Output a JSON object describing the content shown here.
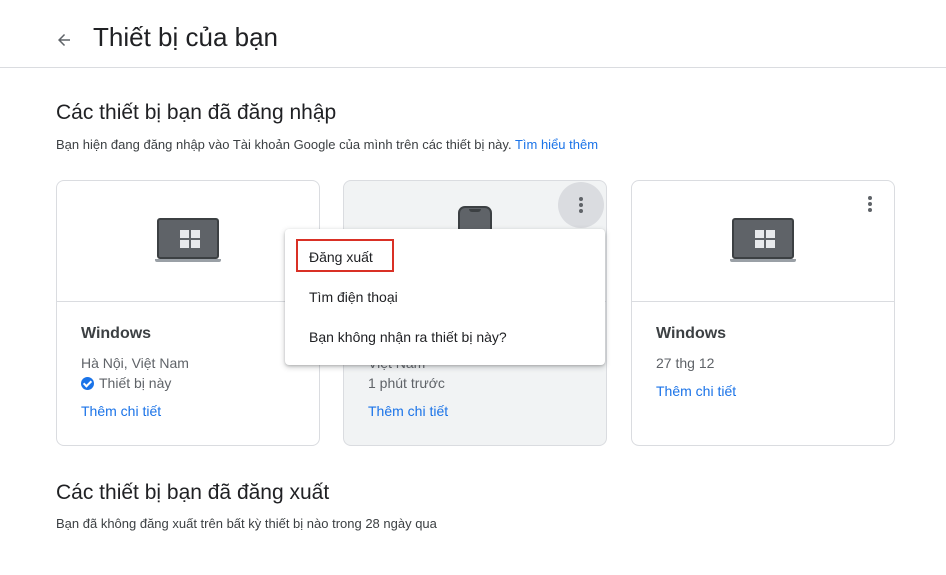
{
  "header": {
    "title": "Thiết bị của bạn",
    "back_icon": "arrow-back-icon"
  },
  "signed_in": {
    "title": "Các thiết bị bạn đã đăng nhập",
    "description": "Bạn hiện đang đăng nhập vào Tài khoản Google của mình trên các thiết bị này.",
    "learn_more": "Tìm hiểu thêm"
  },
  "devices": [
    {
      "icon": "windows-laptop-icon",
      "name": "Windows",
      "location": "Hà Nội, Việt Nam",
      "this_device": "Thiết bị này",
      "details_link": "Thêm chi tiết"
    },
    {
      "icon": "phone-icon",
      "location": "Việt Nam",
      "time": "1 phút trước",
      "details_link": "Thêm chi tiết"
    },
    {
      "icon": "windows-laptop-icon",
      "name": "Windows",
      "date": "27 thg 12",
      "details_link": "Thêm chi tiết"
    }
  ],
  "menu": {
    "items": [
      "Đăng xuất",
      "Tìm điện thoại",
      "Bạn không nhận ra thiết bị này?"
    ]
  },
  "signed_out": {
    "title": "Các thiết bị bạn đã đăng xuất",
    "description": "Bạn đã không đăng xuất trên bất kỳ thiết bị nào trong 28 ngày qua"
  },
  "colors": {
    "link": "#1a73e8",
    "highlight": "#d93025",
    "divider": "#dadce0"
  }
}
